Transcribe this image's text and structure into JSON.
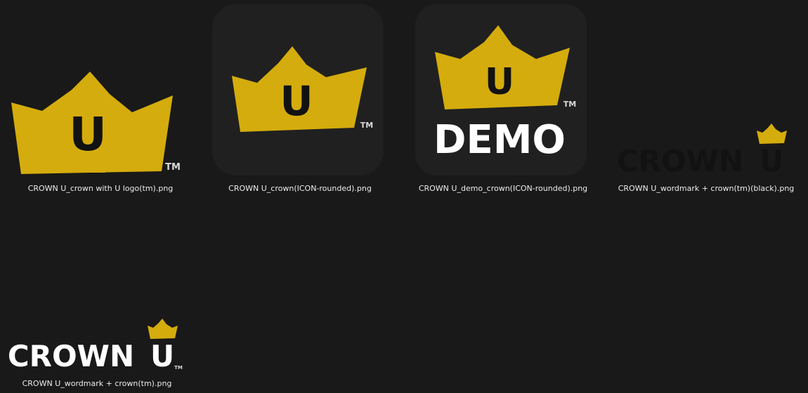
{
  "colors": {
    "background": "#191919",
    "gold": "#d4ac0d",
    "icon_bg": "#202020",
    "dark_text": "#121212",
    "white_text": "#ffffff",
    "caption_text": "#ececec"
  },
  "logo_text": {
    "letter": "U",
    "tm": "TM",
    "demo": "DEMO",
    "wordmark": "CROWN",
    "wordmark_u": "U"
  },
  "files": [
    {
      "name": "CROWN U_crown with U logo(tm).png",
      "thumbnail": "crown-u-logo-icon"
    },
    {
      "name": "CROWN U_crown(ICON-rounded).png",
      "thumbnail": "crown-u-rounded-icon"
    },
    {
      "name": "CROWN U_demo_crown(ICON-rounded).png",
      "thumbnail": "crown-u-demo-rounded-icon"
    },
    {
      "name": "CROWN U_wordmark + crown(tm)(black).png",
      "thumbnail": "crown-u-wordmark-black-icon"
    },
    {
      "name": "CROWN U_wordmark + crown(tm).png",
      "thumbnail": "crown-u-wordmark-white-icon"
    }
  ]
}
